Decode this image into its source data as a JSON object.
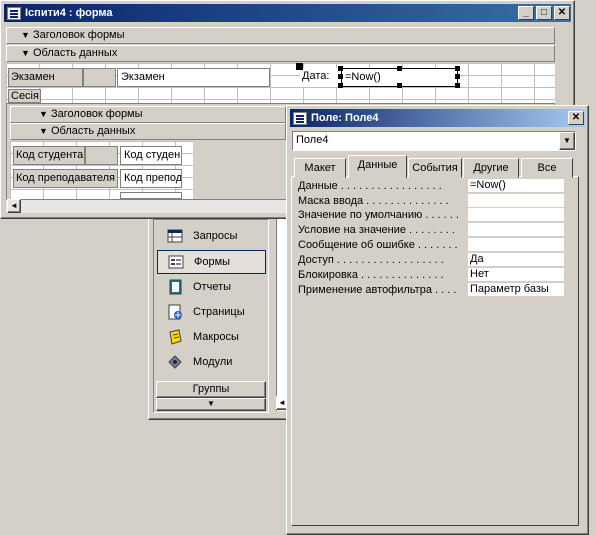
{
  "form_window": {
    "title": "Іспити4 : форма",
    "sections": {
      "header": "Заголовок формы",
      "detail": "Область данных"
    },
    "exam_label": "Экзамен",
    "exam_field": "Экзамен",
    "date_label": "Дата:",
    "date_field": "=Now()",
    "session_label": "Сесія",
    "subform": {
      "sections": {
        "header": "Заголовок формы",
        "detail": "Область данных"
      },
      "rows": [
        {
          "label": "Код студента",
          "field": "Код студен"
        },
        {
          "label": "Код преподавателя",
          "field": "Код препод"
        }
      ]
    }
  },
  "db_nav": {
    "items": [
      {
        "label": "Запросы",
        "icon": "query-icon"
      },
      {
        "label": "Формы",
        "icon": "form-icon"
      },
      {
        "label": "Отчеты",
        "icon": "report-icon"
      },
      {
        "label": "Страницы",
        "icon": "page-icon"
      },
      {
        "label": "Макросы",
        "icon": "macro-icon"
      },
      {
        "label": "Модули",
        "icon": "module-icon"
      }
    ],
    "groups_label": "Группы"
  },
  "properties": {
    "title": "Поле: Поле4",
    "selected_object": "Поле4",
    "tabs": [
      "Макет",
      "Данные",
      "События",
      "Другие",
      "Все"
    ],
    "active_tab": "Данные",
    "rows": [
      {
        "name": "Данные . . . . . . . . . . . . . . . . .",
        "value": "=Now()"
      },
      {
        "name": "Маска ввода . . . . . . . . . . . . . .",
        "value": ""
      },
      {
        "name": "Значение по умолчанию . . . . . .",
        "value": ""
      },
      {
        "name": "Условие на значение . . . . . . . .",
        "value": ""
      },
      {
        "name": "Сообщение об ошибке . . . . . . .",
        "value": ""
      },
      {
        "name": "Доступ . . . . . . . . . . . . . . . . . .",
        "value": "Да"
      },
      {
        "name": "Блокировка . . . . . . . . . . . . . .",
        "value": "Нет"
      },
      {
        "name": "Применение автофильтра . . . .",
        "value": "Параметр базы"
      }
    ]
  },
  "colors": {
    "titlebar_active": "#0a246a",
    "face": "#d4d0c8",
    "selection_border": "#0a246a"
  }
}
